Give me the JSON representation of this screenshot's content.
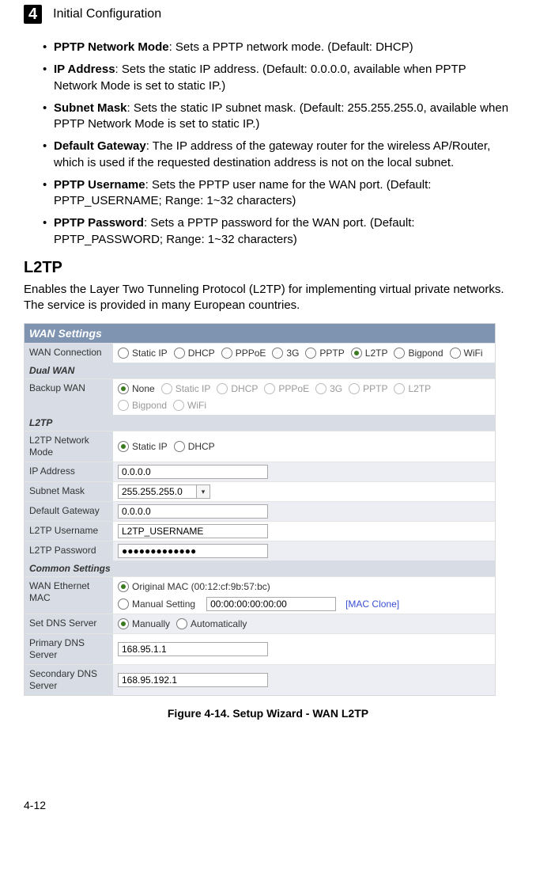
{
  "header": {
    "chapter": "4",
    "title": "Initial Configuration"
  },
  "bullets": [
    {
      "term": "PPTP Network Mode",
      "desc": ": Sets a PPTP network mode. (Default: DHCP)"
    },
    {
      "term": "IP Address",
      "desc": ": Sets the static IP address. (Default: 0.0.0.0, available when PPTP Network Mode is set to static IP.)"
    },
    {
      "term": "Subnet Mask",
      "desc": ": Sets the static IP subnet mask. (Default: 255.255.255.0, available when PPTP Network Mode is set to static IP.)"
    },
    {
      "term": "Default Gateway",
      "desc": ": The IP address of the gateway router for the wireless AP/Router, which is used if the requested destination address is not on the local subnet."
    },
    {
      "term": "PPTP Username",
      "desc": ": Sets the PPTP user name for the WAN port. (Default: PPTP_USERNAME; Range: 1~32 characters)"
    },
    {
      "term": "PPTP Password",
      "desc": ": Sets a PPTP password for the WAN port. (Default: PPTP_PASSWORD; Range: 1~32 characters)"
    }
  ],
  "section": {
    "heading": "L2TP",
    "para": "Enables the Layer Two Tunneling Protocol (L2TP) for implementing virtual private networks. The service is provided in many European countries."
  },
  "panel": {
    "title": "WAN Settings",
    "wan_conn_label": "WAN Connection",
    "wan_conn_opts": [
      "Static IP",
      "DHCP",
      "PPPoE",
      "3G",
      "PPTP",
      "L2TP",
      "Bigpond",
      "WiFi"
    ],
    "wan_conn_sel": "L2TP",
    "dual_wan_title": "Dual WAN",
    "backup_label": "Backup WAN",
    "backup_opts": [
      "None",
      "Static IP",
      "DHCP",
      "PPPoE",
      "3G",
      "PPTP",
      "L2TP",
      "Bigpond",
      "WiFi"
    ],
    "backup_sel": "None",
    "l2tp_title": "L2TP",
    "netmode_label": "L2TP Network Mode",
    "netmode_opts": [
      "Static IP",
      "DHCP"
    ],
    "netmode_sel": "Static IP",
    "ip_label": "IP Address",
    "ip_value": "0.0.0.0",
    "subnet_label": "Subnet Mask",
    "subnet_value": "255.255.255.0",
    "gw_label": "Default Gateway",
    "gw_value": "0.0.0.0",
    "user_label": "L2TP Username",
    "user_value": "L2TP_USERNAME",
    "pass_label": "L2TP Password",
    "pass_value": "●●●●●●●●●●●●●",
    "common_title": "Common Settings",
    "mac_label": "WAN Ethernet MAC",
    "mac_opt1": "Original MAC (00:12:cf:9b:57:bc)",
    "mac_opt2": "Manual Setting",
    "mac_field": "00:00:00:00:00:00",
    "mac_link": "[MAC Clone]",
    "dns_label": "Set DNS Server",
    "dns_opts": [
      "Manually",
      "Automatically"
    ],
    "dns_sel": "Manually",
    "pdns_label": "Primary DNS Server",
    "pdns_value": "168.95.1.1",
    "sdns_label": "Secondary DNS Server",
    "sdns_value": "168.95.192.1"
  },
  "figure_caption": "Figure 4-14.   Setup Wizard - WAN L2TP",
  "page_num": "4-12"
}
